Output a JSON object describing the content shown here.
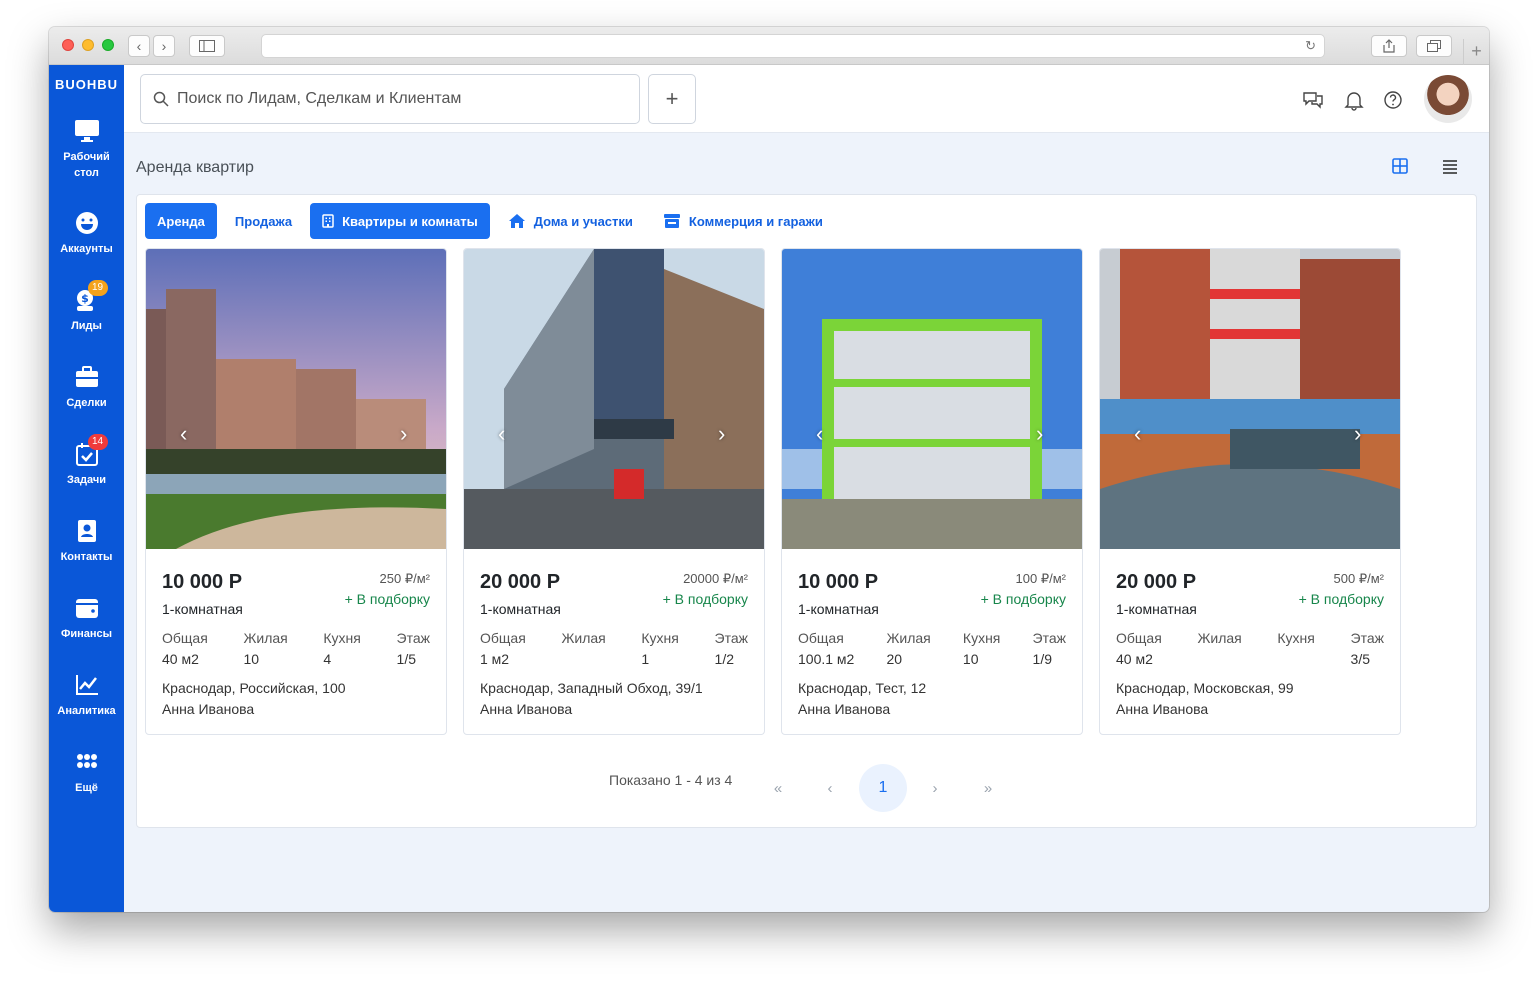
{
  "app": {
    "logo": "BUOHBU"
  },
  "sidebar": {
    "items": [
      {
        "label1": "Рабочий",
        "label2": "стол"
      },
      {
        "label1": "Аккаунты",
        "label2": ""
      },
      {
        "label1": "Лиды",
        "label2": "",
        "badge": "19"
      },
      {
        "label1": "Сделки",
        "label2": ""
      },
      {
        "label1": "Задачи",
        "label2": "",
        "badge": "14"
      },
      {
        "label1": "Контакты",
        "label2": ""
      },
      {
        "label1": "Финансы",
        "label2": ""
      },
      {
        "label1": "Аналитика",
        "label2": ""
      },
      {
        "label1": "Ещё",
        "label2": ""
      }
    ]
  },
  "search": {
    "placeholder": "Поиск по Лидам, Сделкам и Клиентам",
    "value": ""
  },
  "page": {
    "title": "Аренда квартир"
  },
  "tabs": [
    {
      "label": "Аренда"
    },
    {
      "label": "Продажа"
    },
    {
      "label": "Квартиры и комнаты"
    },
    {
      "label": "Дома и участки"
    },
    {
      "label": "Коммерция и гаражи"
    }
  ],
  "spec_labels": {
    "total": "Общая",
    "living": "Жилая",
    "kitchen": "Кухня",
    "floor": "Этаж"
  },
  "add_label": "+ В подборку",
  "listings": [
    {
      "price": "10 000 Р",
      "price_per_m2": "250 ₽/м²",
      "rooms": "1-комнатная",
      "total": "40 м2",
      "living": "10",
      "kitchen": "4",
      "floor": "1/5",
      "address": "Краснодар, Российская, 100",
      "agent": "Анна Иванова"
    },
    {
      "price": "20 000 Р",
      "price_per_m2": "20000 ₽/м²",
      "rooms": "1-комнатная",
      "total": "1 м2",
      "living": "",
      "kitchen": "1",
      "floor": "1/2",
      "address": "Краснодар, Западный Обход, 39/1",
      "agent": "Анна Иванова"
    },
    {
      "price": "10 000 Р",
      "price_per_m2": "100 ₽/м²",
      "rooms": "1-комнатная",
      "total": "100.1 м2",
      "living": "20",
      "kitchen": "10",
      "floor": "1/9",
      "address": "Краснодар, Тест, 12",
      "agent": "Анна Иванова"
    },
    {
      "price": "20 000 Р",
      "price_per_m2": "500 ₽/м²",
      "rooms": "1-комнатная",
      "total": "40 м2",
      "living": "",
      "kitchen": "",
      "floor": "3/5",
      "address": "Краснодар, Московская, 99",
      "agent": "Анна Иванова"
    }
  ],
  "pagination": {
    "summary": "Показано 1 - 4 из 4",
    "first": "«",
    "prev": "‹",
    "current": "1",
    "next": "›",
    "last": "»"
  }
}
